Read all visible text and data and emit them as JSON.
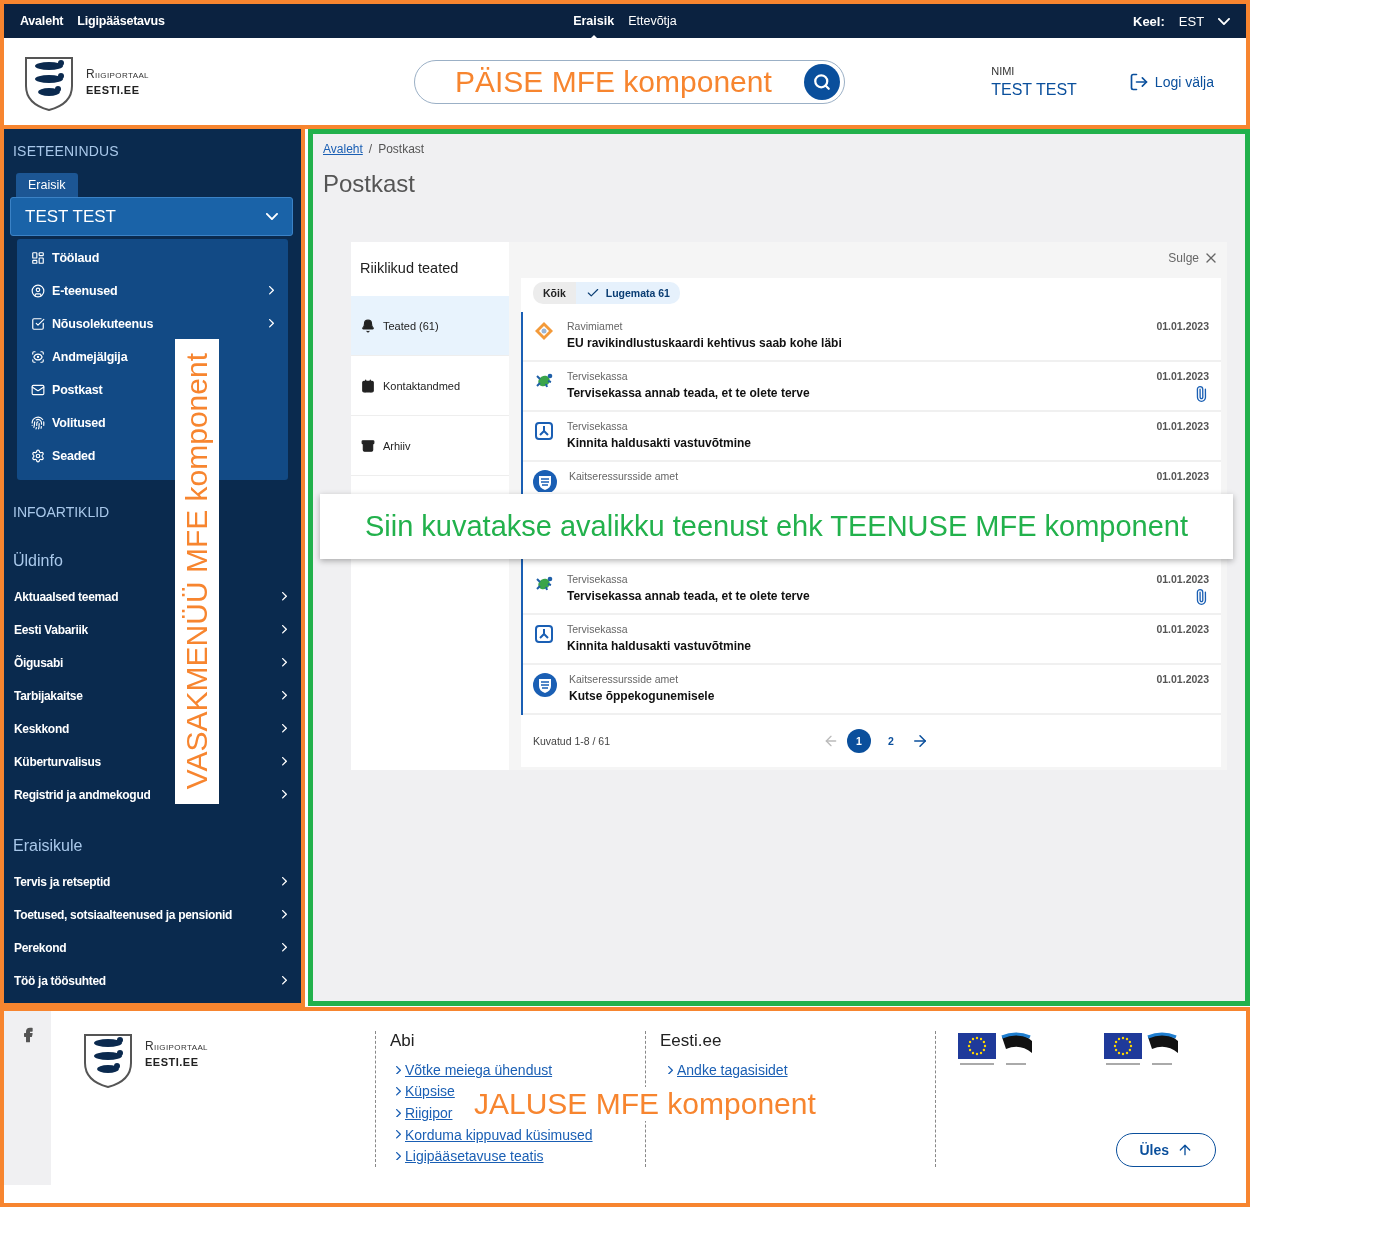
{
  "header": {
    "top_left_links": [
      "Avaleht",
      "Ligipääsetavus"
    ],
    "audience_tabs": [
      {
        "label": "Eraisik",
        "selected": true
      },
      {
        "label": "Ettevõtja",
        "selected": false
      }
    ],
    "language": {
      "label": "Keel:",
      "value": "EST"
    },
    "logo": {
      "title": "Riigiportaal",
      "subtitle": "EESTI.EE"
    },
    "search": {
      "annotation": "PÄISE MFE komponent"
    },
    "user": {
      "label": "NIMI",
      "name": "TEST TEST"
    },
    "logout": "Logi välja"
  },
  "sidebar": {
    "section_title": "ISETEENINDUS",
    "role_tab": "Eraisik",
    "account": {
      "name": "TEST TEST",
      "expanded": true
    },
    "account_menu": [
      {
        "label": "Töölaud",
        "has_submenu": false
      },
      {
        "label": "E-teenused",
        "has_submenu": true
      },
      {
        "label": "Nõusolekuteenus",
        "has_submenu": true
      },
      {
        "label": "Andmejälgija",
        "has_submenu": false
      },
      {
        "label": "Postkast",
        "has_submenu": false
      },
      {
        "label": "Volitused",
        "has_submenu": false
      },
      {
        "label": "Seaded",
        "has_submenu": false
      }
    ],
    "info_title": "INFOARTIKLID",
    "groups": [
      {
        "title": "Üldinfo",
        "items": [
          "Aktuaalsed teemad",
          "Eesti Vabariik",
          "Õigusabi",
          "Tarbijakaitse",
          "Keskkond",
          "Küberturvalisus",
          "Registrid ja andmekogud"
        ]
      },
      {
        "title": "Eraisikule",
        "items": [
          "Tervis ja retseptid",
          "Toetused, sotsiaalteenused ja pensionid",
          "Perekond",
          "Töö ja töösuhted"
        ]
      }
    ],
    "annotation": "VASAKMENÜÜ MFE komponent"
  },
  "main": {
    "breadcrumb": [
      {
        "label": "Avaleht",
        "link": true
      },
      {
        "label": "Postkast",
        "link": false
      }
    ],
    "breadcrumb_separator": "/",
    "title": "Postkast",
    "inbox": {
      "title": "Riiklikud teated",
      "nav": [
        {
          "label": "Teated (61)",
          "selected": true
        },
        {
          "label": "Kontaktandmed",
          "selected": false
        },
        {
          "label": "Arhiiv",
          "selected": false
        }
      ],
      "close": "Sulge",
      "filters": [
        {
          "label": "Kõik",
          "selected": false
        },
        {
          "label": "Lugemata 61",
          "selected": true
        }
      ],
      "messages": [
        {
          "kind": "ravimiamet",
          "sender": "Ravimiamet",
          "title": "EU ravikindlustuskaardi kehtivus saab kohe läbi",
          "date": "01.01.2023",
          "attachment": false
        },
        {
          "kind": "tervisekassa",
          "sender": "Tervisekassa",
          "title": "Tervisekassa annab teada, et te olete terve",
          "date": "01.01.2023",
          "attachment": true
        },
        {
          "kind": "document",
          "sender": "Tervisekassa",
          "title": "Kinnita haldusakti vastuvõtmine",
          "date": "01.01.2023",
          "attachment": false
        },
        {
          "kind": "crest",
          "sender": "Kaitseressursside amet",
          "date": "01.01.2023",
          "attachment": false
        },
        {
          "kind": "tervisekassa",
          "sender": "Tervisekassa",
          "title": "Tervisekassa annab teada, et te olete terve",
          "date": "01.01.2023",
          "attachment": true
        },
        {
          "kind": "document",
          "sender": "Tervisekassa",
          "title": "Kinnita haldusakti vastuvõtmine",
          "date": "01.01.2023",
          "attachment": false
        },
        {
          "kind": "crest",
          "sender": "Kaitseressursside amet",
          "title": "Kutse õppekogunemisele",
          "date": "01.01.2023",
          "attachment": false
        }
      ],
      "summary": "Kuvatud 1-8 / 61",
      "pages": [
        {
          "label": "1",
          "selected": true
        },
        {
          "label": "2",
          "selected": false
        }
      ]
    },
    "annotation": "Siin kuvatakse avalikku teenust ehk TEENUSE MFE komponent"
  },
  "footer": {
    "logo": {
      "title": "Riigiportaal",
      "subtitle": "EESTI.EE"
    },
    "columns": [
      {
        "title": "Abi",
        "links": [
          "Võtke meiega ühendust",
          "Küpsise",
          "Riigipor",
          "Korduma kippuvad küsimused",
          "Ligipääsetavuse teatis"
        ]
      },
      {
        "title": "Eesti.ee",
        "links": [
          "Andke tagasisidet"
        ]
      }
    ],
    "to_top": "Üles",
    "annotation": "JALUSE MFE komponent"
  }
}
